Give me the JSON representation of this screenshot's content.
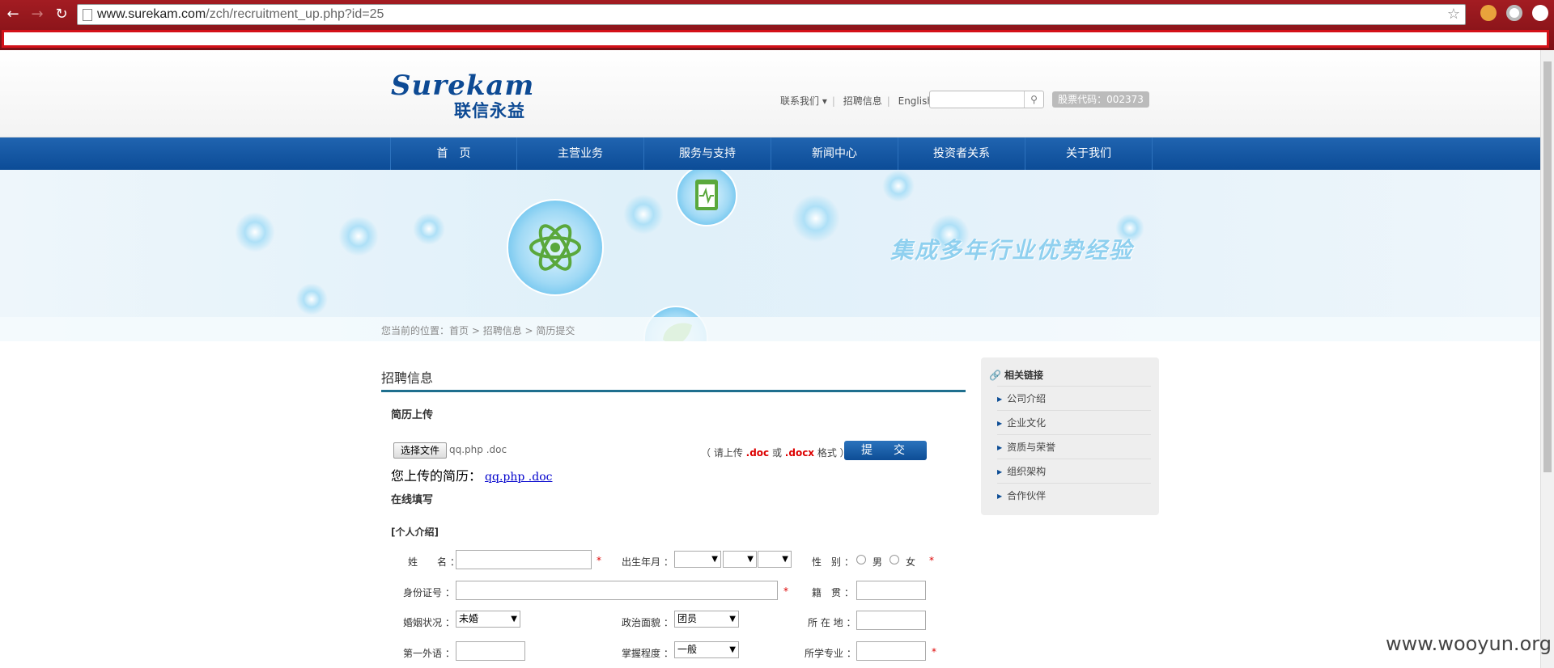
{
  "browser": {
    "url_host": "www.surekam.com",
    "url_path": "/zch/recruitment_up.php?id=25"
  },
  "header": {
    "logo_en": "Surekam",
    "logo_cn": "联信永益",
    "links": [
      "联系我们 ▾",
      "招聘信息",
      "English"
    ],
    "search_placeholder": "",
    "stock_label": "股票代码：002373"
  },
  "nav": {
    "items": [
      "首　页",
      "主营业务",
      "服务与支持",
      "新闻中心",
      "投资者关系",
      "关于我们"
    ]
  },
  "banner": {
    "slogan": "集成多年行业优势经验"
  },
  "breadcrumb": {
    "prefix": "您当前的位置：",
    "home": "首页",
    "sep": " > ",
    "section": "招聘信息",
    "current": "简历提交"
  },
  "main": {
    "title": "招聘信息",
    "upload_heading": "简历上传",
    "file_button": "选择文件",
    "file_name": "qq.php .doc",
    "hint_prefix": "（ 请上传 ",
    "hint_doc": ".doc",
    "hint_or": " 或 ",
    "hint_docx": ".docx",
    "hint_suffix": " 格式 ）",
    "submit_label": "提　交",
    "uploaded_label": "您上传的简历：",
    "uploaded_file": "qq.php .doc",
    "online_heading": "在线填写",
    "personal_heading": "[个人介绍]"
  },
  "form": {
    "name_label": "姓　　名 ：",
    "birth_label": "出生年月 ：",
    "gender_label": "性　别 ：",
    "gender_male": "男",
    "gender_female": "女",
    "id_label": "身份证号 ：",
    "native_label": "籍　贯 ：",
    "marital_label": "婚姻状况 ：",
    "marital_value": "未婚",
    "political_label": "政治面貌 ：",
    "political_value": "团员",
    "location_label": "所 在 地 ：",
    "language_label": "第一外语 ：",
    "level_label": "掌握程度 ：",
    "level_value": "一般",
    "major_label": "所学专业 ：",
    "required_mark": "*"
  },
  "sidebar": {
    "heading": "相关链接",
    "items": [
      "公司介绍",
      "企业文化",
      "资质与荣誉",
      "组织架构",
      "合作伙伴"
    ]
  },
  "watermark": "www.wooyun.org"
}
